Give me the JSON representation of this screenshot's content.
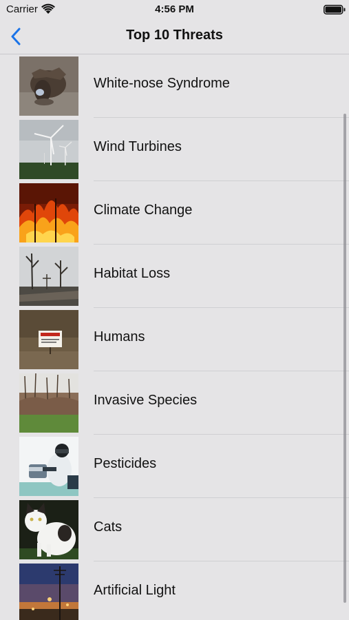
{
  "status_bar": {
    "carrier": "Carrier",
    "time": "4:56 PM"
  },
  "nav": {
    "title": "Top 10 Threats",
    "back_icon": "chevron-left-icon",
    "accent_color": "#1a73e8"
  },
  "threats": [
    {
      "label": "White-nose Syndrome",
      "image": "bat-photo"
    },
    {
      "label": "Wind Turbines",
      "image": "wind-turbines-photo"
    },
    {
      "label": "Climate Change",
      "image": "forest-fire-photo"
    },
    {
      "label": "Habitat Loss",
      "image": "burned-trees-photo"
    },
    {
      "label": "Humans",
      "image": "danger-sign-photo"
    },
    {
      "label": "Invasive Species",
      "image": "bare-woodland-photo"
    },
    {
      "label": "Pesticides",
      "image": "hazmat-worker-photo"
    },
    {
      "label": "Cats",
      "image": "cat-photo"
    },
    {
      "label": "Artificial Light",
      "image": "street-lights-night-photo"
    }
  ]
}
